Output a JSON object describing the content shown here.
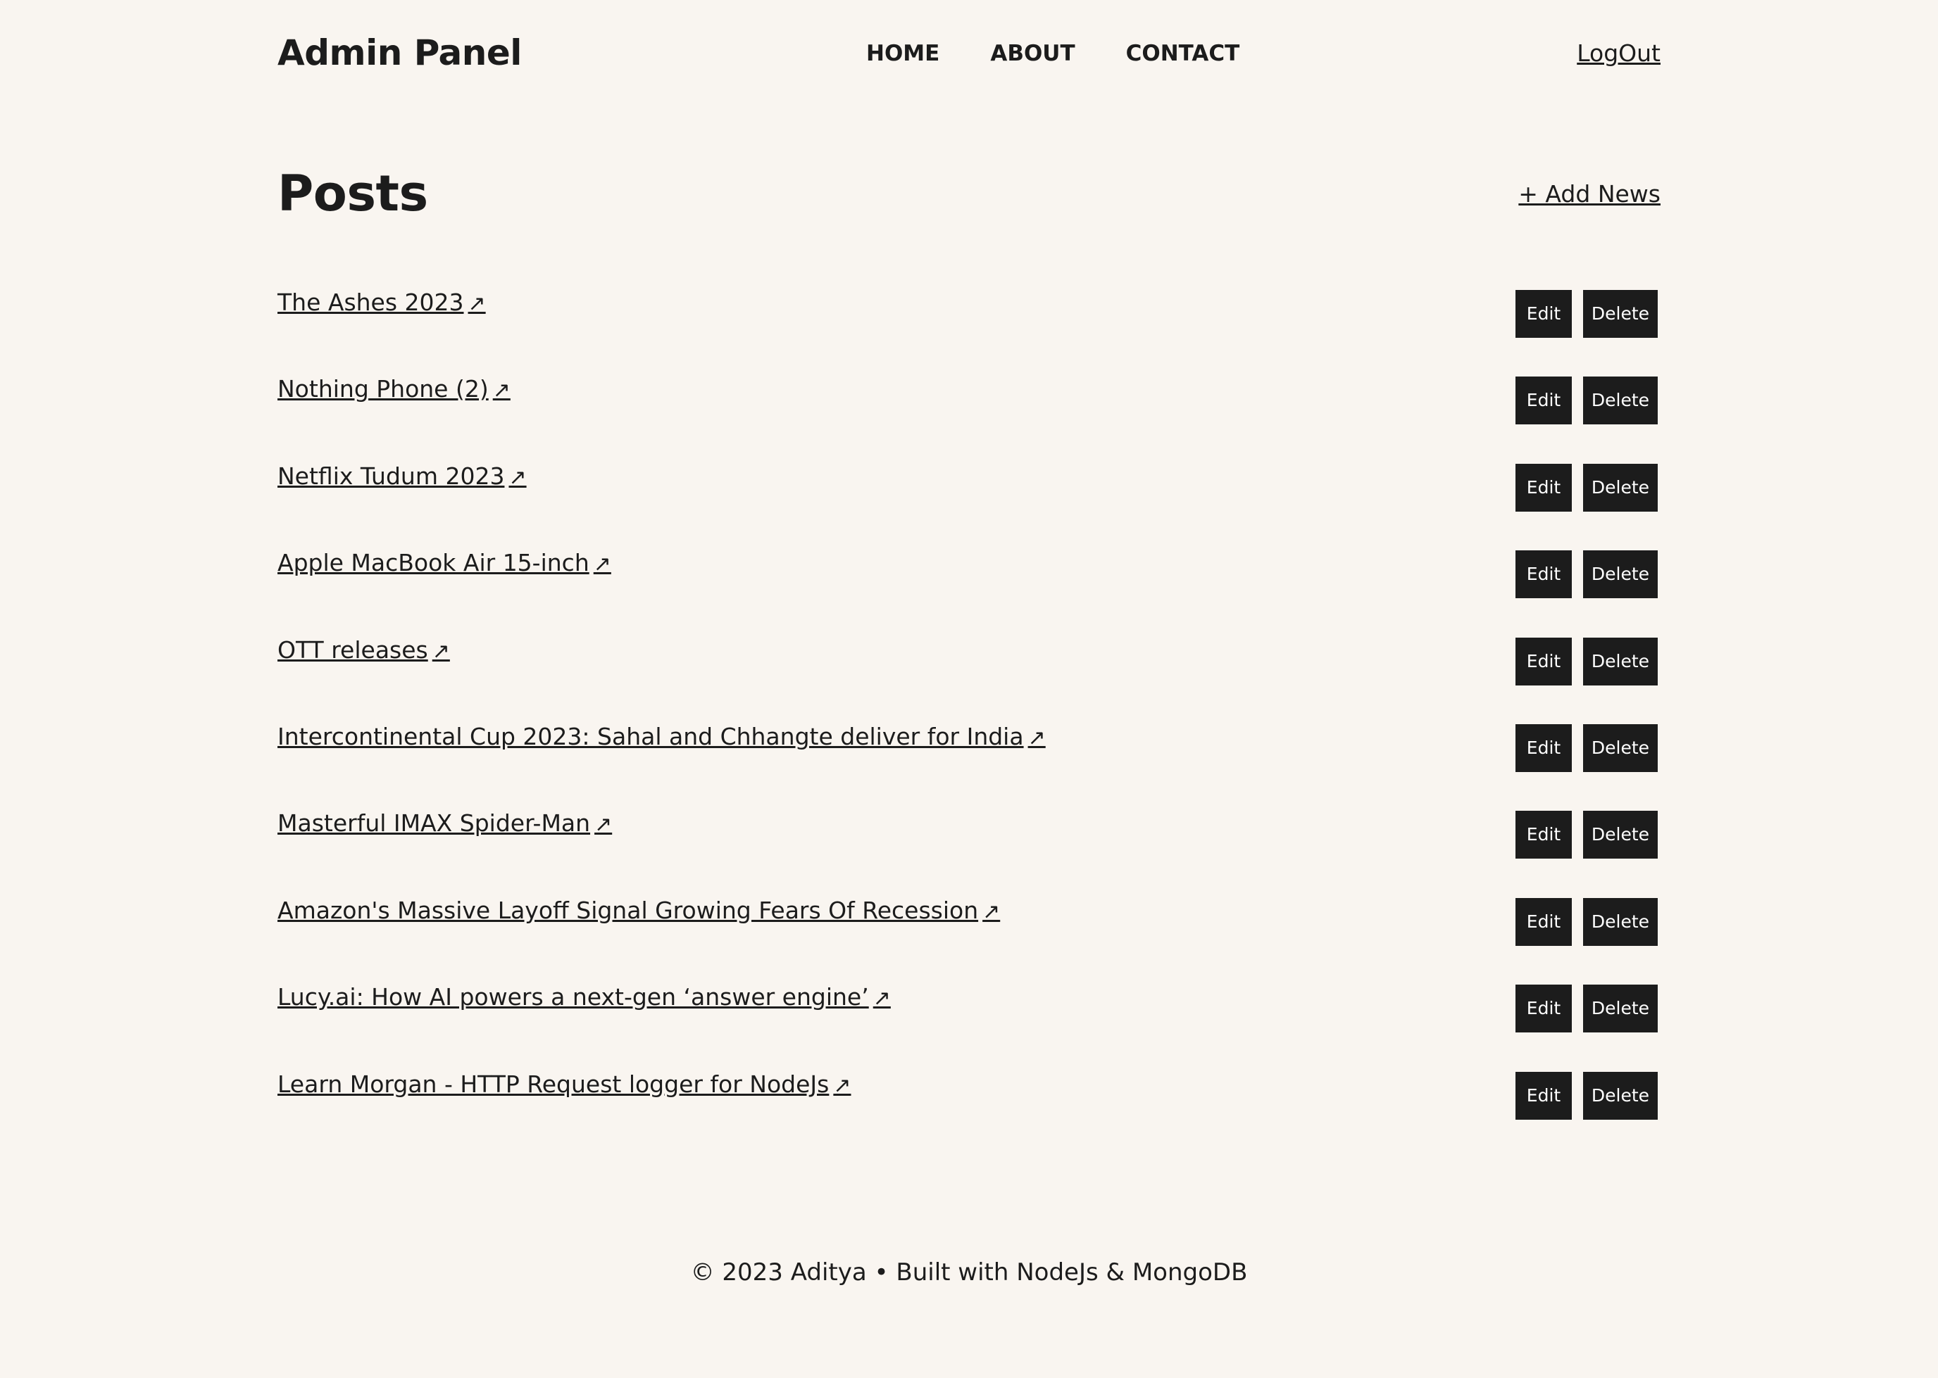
{
  "header": {
    "brand": "Admin Panel",
    "nav": [
      {
        "label": "HOME"
      },
      {
        "label": "ABOUT"
      },
      {
        "label": "CONTACT"
      }
    ],
    "logout_label": "LogOut"
  },
  "main": {
    "title": "Posts",
    "add_label": "+ Add News",
    "edit_label": "Edit",
    "delete_label": "Delete",
    "external_link_icon": "↗",
    "posts": [
      {
        "title": "The Ashes 2023"
      },
      {
        "title": "Nothing Phone (2)"
      },
      {
        "title": "Netflix Tudum 2023"
      },
      {
        "title": "Apple MacBook Air 15-inch"
      },
      {
        "title": "OTT releases"
      },
      {
        "title": "Intercontinental Cup 2023: Sahal and Chhangte deliver for India"
      },
      {
        "title": "Masterful IMAX Spider-Man"
      },
      {
        "title": "Amazon's Massive Layoff Signal Growing Fears Of Recession"
      },
      {
        "title": "Lucy.ai: How AI powers a next-gen ‘answer engine’"
      },
      {
        "title": "Learn Morgan - HTTP Request logger for NodeJs"
      }
    ]
  },
  "footer": {
    "text": "© 2023 Aditya • Built with NodeJs & MongoDB"
  },
  "colors": {
    "background": "#f9f5f0",
    "text": "#1c1c1c",
    "button_bg": "#1c1c1c",
    "button_text": "#ffffff"
  }
}
